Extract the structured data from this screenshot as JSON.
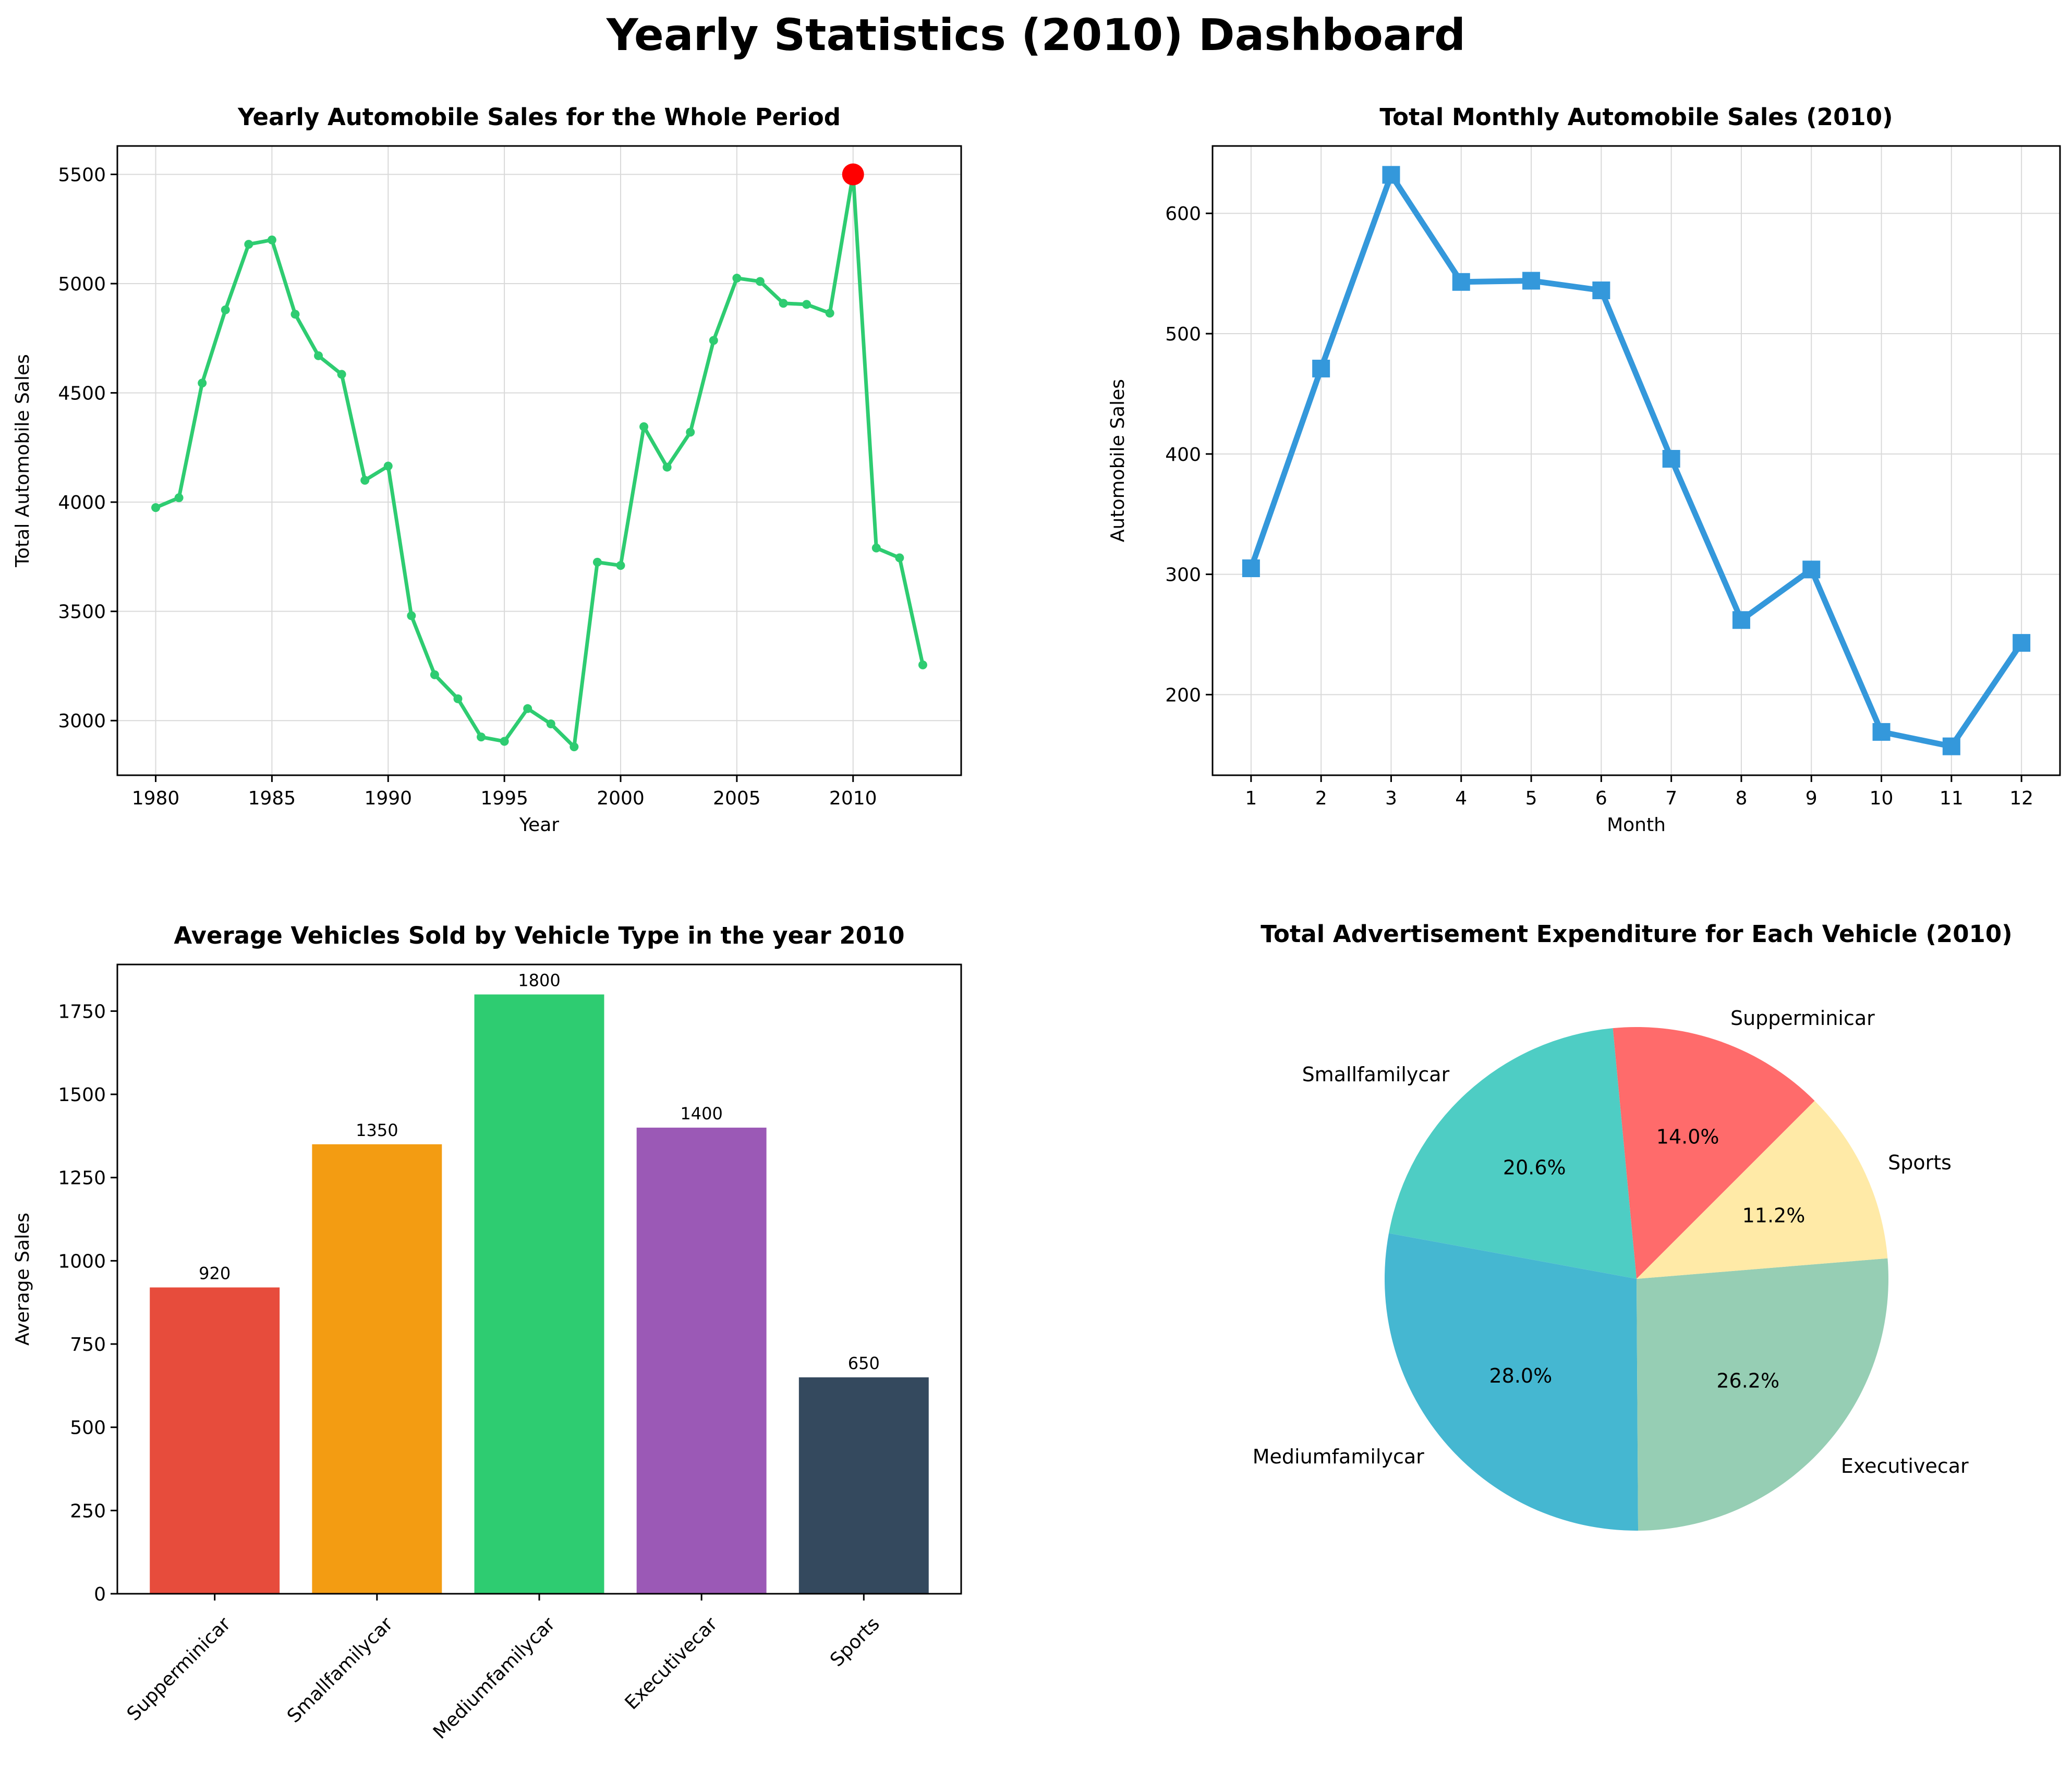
{
  "dashboard": {
    "title": "Yearly Statistics (2010) Dashboard"
  },
  "chart_data": [
    {
      "id": "yearly",
      "type": "line",
      "title": "Yearly Automobile Sales for the Whole Period",
      "xlabel": "Year",
      "ylabel": "Total Automobile Sales",
      "x": [
        1980,
        1981,
        1982,
        1983,
        1984,
        1985,
        1986,
        1987,
        1988,
        1989,
        1990,
        1991,
        1992,
        1993,
        1994,
        1995,
        1996,
        1997,
        1998,
        1999,
        2000,
        2001,
        2002,
        2003,
        2004,
        2005,
        2006,
        2007,
        2008,
        2009,
        2010,
        2011,
        2012,
        2013
      ],
      "y": [
        3975,
        4020,
        4545,
        4880,
        5180,
        5200,
        4860,
        4670,
        4585,
        4100,
        4165,
        3480,
        3210,
        3100,
        2925,
        2905,
        3055,
        2985,
        2880,
        3725,
        3710,
        4345,
        4160,
        4320,
        4740,
        5025,
        5010,
        4910,
        4905,
        4865,
        5500,
        3790,
        3745,
        3255
      ],
      "xlim": [
        1978.35,
        2014.65
      ],
      "ylim": [
        2750,
        5630
      ],
      "xticks": [
        1980,
        1985,
        1990,
        1995,
        2000,
        2005,
        2010
      ],
      "yticks": [
        3000,
        3500,
        4000,
        4500,
        5000,
        5500
      ],
      "highlight": {
        "x": 2010,
        "y": 5500,
        "color": "#ff0000"
      },
      "color": "#2ecc71",
      "grid": true
    },
    {
      "id": "monthly",
      "type": "line",
      "title": "Total Monthly Automobile Sales (2010)",
      "xlabel": "Month",
      "ylabel": "Automobile Sales",
      "x": [
        1,
        2,
        3,
        4,
        5,
        6,
        7,
        8,
        9,
        10,
        11,
        12
      ],
      "y": [
        305,
        471,
        632,
        543,
        544,
        536,
        396,
        262,
        304,
        169,
        157,
        243
      ],
      "xlim": [
        0.45,
        12.55
      ],
      "ylim": [
        133,
        656
      ],
      "xticks": [
        1,
        2,
        3,
        4,
        5,
        6,
        7,
        8,
        9,
        10,
        11,
        12
      ],
      "yticks": [
        200,
        300,
        400,
        500,
        600
      ],
      "marker": "square",
      "color": "#3498db",
      "grid": true
    },
    {
      "id": "vehicle-type",
      "type": "bar",
      "title": "Average Vehicles Sold by Vehicle Type in the year 2010",
      "xlabel": "",
      "ylabel": "Average Sales",
      "categories": [
        "Supperminicar",
        "Smallfamilycar",
        "Mediumfamilycar",
        "Executivecar",
        "Sports"
      ],
      "values": [
        920,
        1350,
        1800,
        1400,
        650
      ],
      "colors": [
        "#e74c3c",
        "#f39c12",
        "#2ecc71",
        "#9b59b6",
        "#34495e"
      ],
      "ylim": [
        0,
        1890
      ],
      "yticks": [
        0,
        250,
        500,
        750,
        1000,
        1250,
        1500,
        1750
      ],
      "data_labels": true
    },
    {
      "id": "ad-expenditure",
      "type": "pie",
      "title": "Total Advertisement Expenditure for Each Vehicle (2010)",
      "slices": [
        {
          "label": "Supperminicar",
          "value": 14.0,
          "pct_label": "14.0%",
          "color": "#ff6b6b"
        },
        {
          "label": "Smallfamilycar",
          "value": 20.6,
          "pct_label": "20.6%",
          "color": "#4ecdc4"
        },
        {
          "label": "Mediumfamilycar",
          "value": 28.0,
          "pct_label": "28.0%",
          "color": "#45b7d1"
        },
        {
          "label": "Executivecar",
          "value": 26.2,
          "pct_label": "26.2%",
          "color": "#96ceb4"
        },
        {
          "label": "Sports",
          "value": 11.2,
          "pct_label": "11.2%",
          "color": "#ffeaa7"
        }
      ],
      "start_angle": 45
    }
  ]
}
